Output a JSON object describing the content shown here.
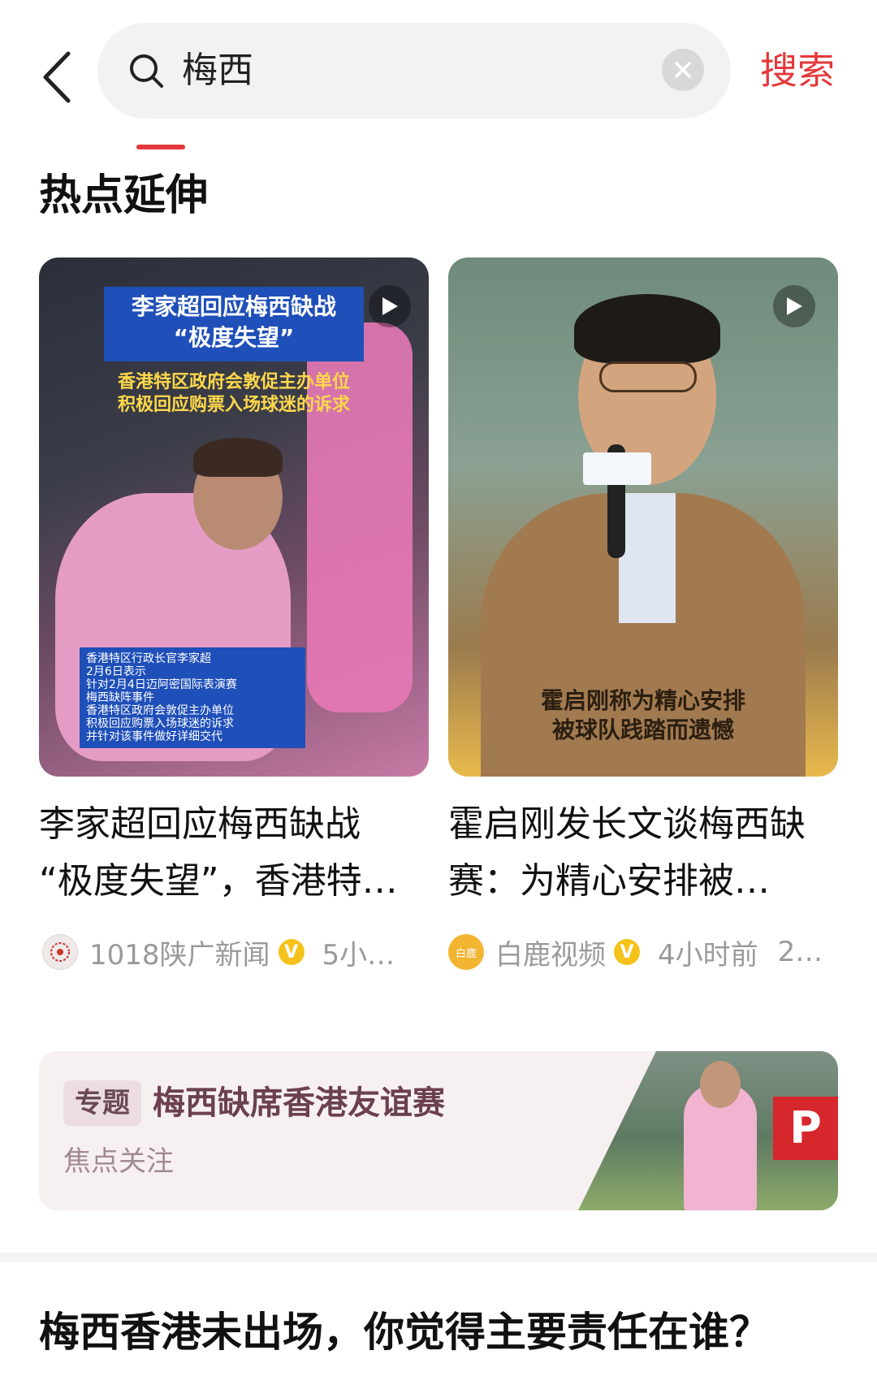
{
  "search": {
    "query": "梅西",
    "submit_label": "搜索"
  },
  "section": {
    "title": "热点延伸"
  },
  "cards": [
    {
      "overlay": {
        "headline_line1": "李家超回应梅西缺战",
        "headline_line2": "“极度失望”",
        "sub_line1": "香港特区政府会敦促主办单位",
        "sub_line2": "积极回应购票入场球迷的诉求",
        "note_lines": [
          "香港特区行政长官李家超",
          "2月6日表示",
          "针对2月4日迈阿密国际表演赛",
          "梅西缺阵事件",
          "香港特区政府会敦促主办单位",
          "积极回应购票入场球迷的诉求",
          "并针对该事件做好详细交代"
        ]
      },
      "title_line1": "李家超回应梅西缺战",
      "title_line2": "“极度失望”，香港特…",
      "source": "1018陕广新闻",
      "time": "5小…",
      "avatar_color": "#e8e2e2"
    },
    {
      "overlay": {
        "caption_line1": "霍启刚称为精心安排",
        "caption_line2": "被球队践踏而遗憾"
      },
      "title_line1": "霍启刚发长文谈梅西缺",
      "title_line2": "赛：为精心安排被…",
      "source": "白鹿视频",
      "avatar_text": "白鹿",
      "time": "4小时前",
      "extra": "2…",
      "avatar_color": "#f2b531"
    }
  ],
  "topic": {
    "tag": "专题",
    "title": "梅西缺席香港友谊赛",
    "subtitle": "焦点关注"
  },
  "question": "梅西香港未出场，你觉得主要责任在谁？",
  "colors": {
    "accent": "#e5383b",
    "verified": "#f4c21a"
  }
}
